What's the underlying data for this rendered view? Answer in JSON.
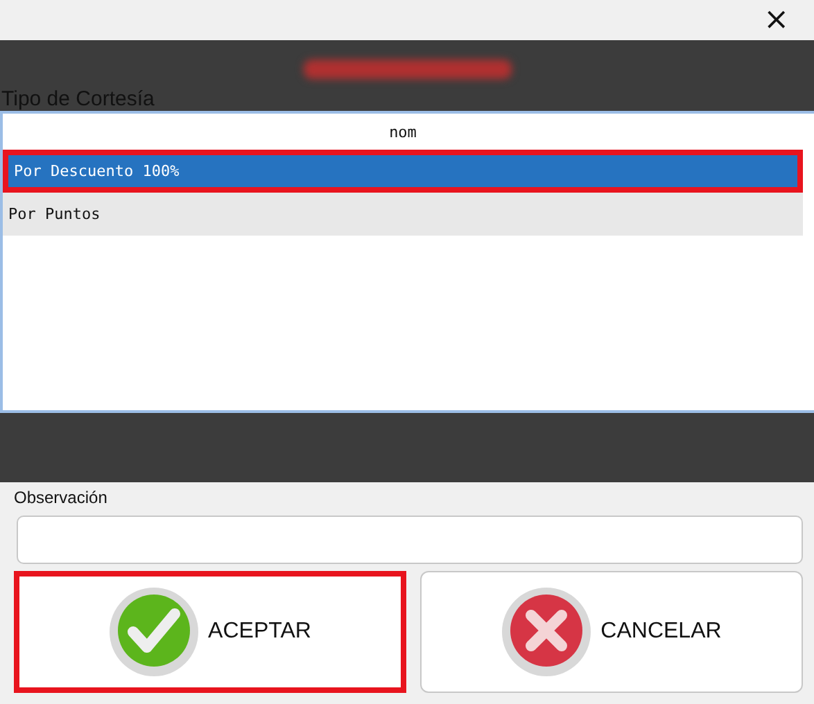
{
  "window": {
    "close": "×"
  },
  "courtesy_type": {
    "label": "Tipo de Cortesía",
    "column": "nom",
    "rows": [
      {
        "text": "Por Descuento 100%",
        "selected": true,
        "highlighted": true
      },
      {
        "text": "Por Puntos",
        "selected": false,
        "highlighted": false
      }
    ]
  },
  "observation": {
    "label": "Observación"
  },
  "buttons": [
    {
      "kind": "accept",
      "label": "ACEPTAR",
      "highlighted": true
    },
    {
      "kind": "cancel",
      "label": "CANCELAR",
      "highlighted": false
    }
  ]
}
